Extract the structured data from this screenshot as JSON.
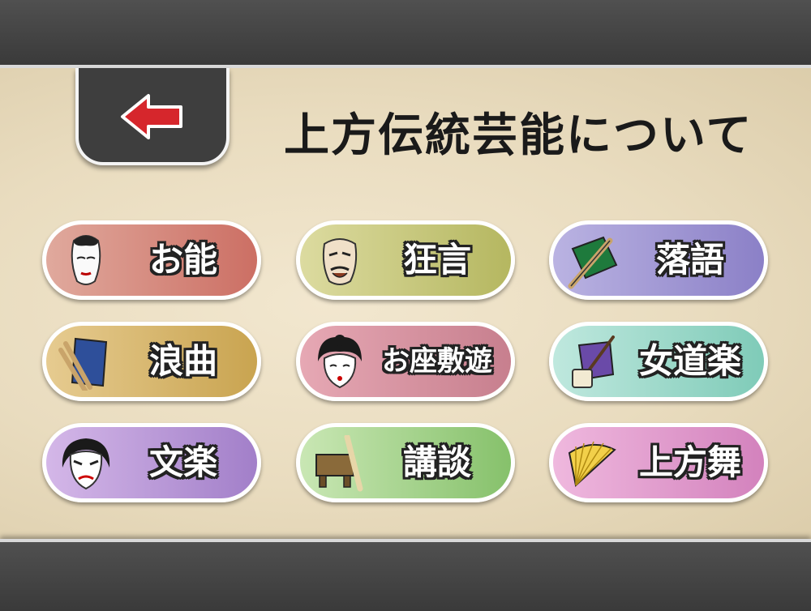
{
  "title": "上方伝統芸能について",
  "back_icon": "back-arrow-icon",
  "colors": {
    "arrow": "#d6262c",
    "bar": "#444444",
    "paper": "#ece0c5"
  },
  "buttons": [
    {
      "label": "お能",
      "icon": "noh-mask-icon"
    },
    {
      "label": "狂言",
      "icon": "kyogen-mask-icon"
    },
    {
      "label": "落語",
      "icon": "fan-and-cloth-icon"
    },
    {
      "label": "浪曲",
      "icon": "book-and-fan-icon"
    },
    {
      "label": "お座敷遊",
      "icon": "geisha-face-icon"
    },
    {
      "label": "女道楽",
      "icon": "shamisen-icon"
    },
    {
      "label": "文楽",
      "icon": "bunraku-puppet-face-icon"
    },
    {
      "label": "講談",
      "icon": "wooden-desk-and-clapper-icon"
    },
    {
      "label": "上方舞",
      "icon": "folding-fan-icon"
    }
  ]
}
